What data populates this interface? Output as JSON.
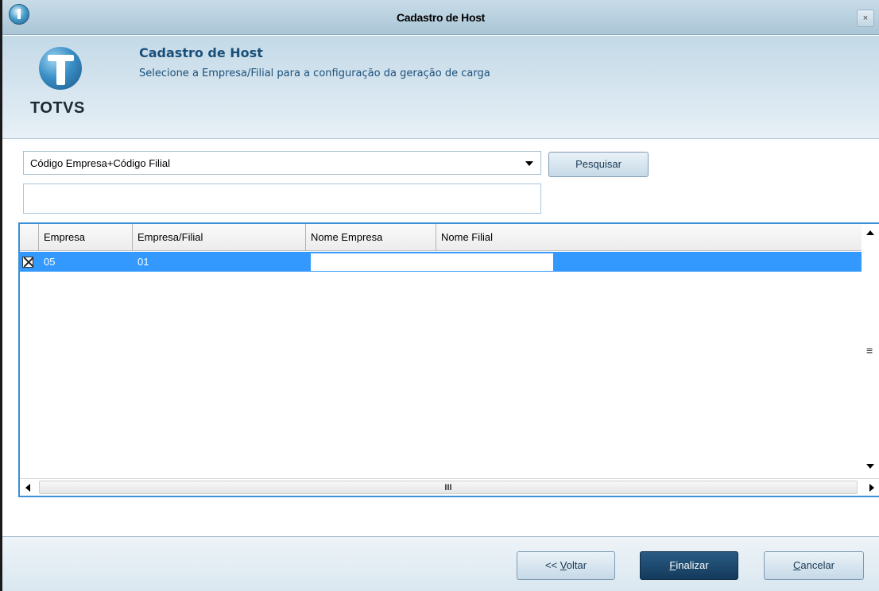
{
  "window": {
    "title": "Cadastro de Host",
    "close_label": "×"
  },
  "header": {
    "title": "Cadastro de Host",
    "subtitle": "Selecione a Empresa/Filial para a configuração da geração de carga",
    "logo_text": "TOTVS"
  },
  "search": {
    "index_value": "Código Empresa+Código Filial",
    "button_label": "Pesquisar",
    "query_value": ""
  },
  "grid": {
    "columns": [
      "Empresa",
      "Empresa/Filial",
      "Nome Empresa",
      "Nome Filial"
    ],
    "rows": [
      {
        "checked": true,
        "empresa": "05",
        "empresa_filial": "01",
        "nome_empresa": "",
        "nome_filial": ""
      }
    ],
    "scroll_grip": "≡",
    "hscroll_grip": "III"
  },
  "footer": {
    "back_prefix": "<< ",
    "back_mnemonic": "V",
    "back_rest": "oltar",
    "finish_mnemonic": "F",
    "finish_rest": "inalizar",
    "cancel_mnemonic": "C",
    "cancel_rest": "ancelar"
  },
  "colors": {
    "selection": "#3399ff",
    "header_text": "#1a4f7a",
    "primary_button": "#1d4670"
  }
}
